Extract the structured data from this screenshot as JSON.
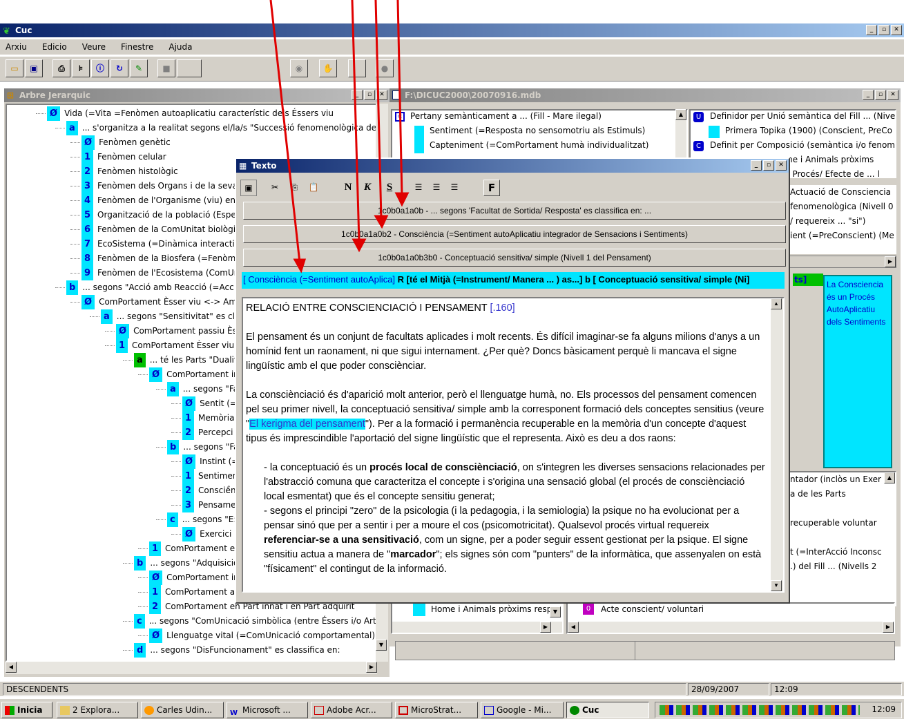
{
  "app": {
    "title": "Cuc"
  },
  "menu": [
    "Arxiu",
    "Edicio",
    "Veure",
    "Finestre",
    "Ajuda"
  ],
  "tree_window": {
    "title": "Arbre Jerarquic"
  },
  "tree_items": [
    {
      "badge": "Ø",
      "text": "Vida (=Vita =Fenòmen autoaplicatiu característic dels Éssers viu"
    },
    {
      "badge": "a",
      "text": "... s'organitza a la realitat segons el/la/s \"Successió fenomenològica de"
    },
    {
      "badge": "Ø",
      "text": "Fenòmen genètic"
    },
    {
      "badge": "1",
      "text": "Fenòmen celular"
    },
    {
      "badge": "2",
      "text": "Fenòmen histològic"
    },
    {
      "badge": "3",
      "text": "Fenòmen dels Organs i de la seva"
    },
    {
      "badge": "4",
      "text": "Fenòmen de l'Organisme (viu) en"
    },
    {
      "badge": "5",
      "text": "Organització de la població (Espe"
    },
    {
      "badge": "6",
      "text": "Fenòmen de la ComUnitat biològic"
    },
    {
      "badge": "7",
      "text": "EcoSistema (=Dinàmica interactiv"
    },
    {
      "badge": "8",
      "text": "Fenòmen de la Biosfera (=Fenòme"
    },
    {
      "badge": "9",
      "text": "Fenòmen de l'Ecosistema (ComUr"
    },
    {
      "badge": "b",
      "text": "... segons \"Acció amb Reacció (=Acc"
    },
    {
      "badge": "Ø",
      "text": "ComPortament Èsser viu <-> Amb"
    },
    {
      "badge": "a",
      "text": "... segons \"Sensitivitat\" es cla"
    },
    {
      "badge": "Ø",
      "text": "ComPortament passiu Èss"
    },
    {
      "badge": "1",
      "text": "ComPortament Èsser viu -"
    },
    {
      "badge": "a",
      "text": "... té les Parts \"Dualit"
    },
    {
      "badge": "Ø",
      "text": "ComPortament in"
    },
    {
      "badge": "a",
      "text": "... segons \"Fa"
    },
    {
      "badge": "Ø",
      "text": "Sentit (=F"
    },
    {
      "badge": "1",
      "text": "Memòria"
    },
    {
      "badge": "2",
      "text": "Percepci"
    },
    {
      "badge": "b",
      "text": "... segons \"Fa"
    },
    {
      "badge": "Ø",
      "text": "Instint (=I"
    },
    {
      "badge": "1",
      "text": "Sentimen"
    },
    {
      "badge": "2",
      "text": "Consciền"
    },
    {
      "badge": "3",
      "text": "Pensame"
    },
    {
      "badge": "c",
      "text": "... segons \"E:"
    },
    {
      "badge": "Ø",
      "text": "Exercici ("
    },
    {
      "badge": "1",
      "text": "ComPortament ex"
    },
    {
      "badge": "b",
      "text": "... segons \"Adquisició"
    },
    {
      "badge": "Ø",
      "text": "ComPortament in"
    },
    {
      "badge": "1",
      "text": "ComPortament ad"
    },
    {
      "badge": "2",
      "text": "ComPortament en Part innat i en Part adquirit"
    },
    {
      "badge": "c",
      "text": "... segons \"ComUnicació simbòlica (entre Éssers i/o Art"
    },
    {
      "badge": "Ø",
      "text": "Llenguatge vital (=ComUnicació comportamental)"
    },
    {
      "badge": "d",
      "text": "... segons \"DisFuncionament\" es classifica en:"
    }
  ],
  "db_window": {
    "title": "F:\\DICUC2000\\20070916.mdb"
  },
  "db_left": [
    "Pertany semànticament a ... (Fill - Mare ilegal)",
    "Sentiment (=Resposta no sensomotriu als Estimuls)",
    "Capteniment (=ComPortament humà individualitzat)"
  ],
  "db_right": [
    "Definidor per Unió semàntica del Fill ... (Nive",
    "Primera Topika (1900) (Conscient, PreCo",
    "Definit per Composició (semàntica i/o fenom",
    "me i Animals pròxims",
    "n/ Procés/ Efecte de ... |",
    "Actuació de Consciencia",
    "fenomenològica (Nivell 0",
    "/ requereix ... \"si\")",
    "ient (=PreConscient) (Me"
  ],
  "db_bottom_left": [
    "Home i Animals pròxims respe"
  ],
  "db_bottom_right": [
    "Acte conscient/ voluntari"
  ],
  "db_mid_right": [
    "ntador (inclòs un Exer",
    "a de les Parts",
    "recuperable voluntar",
    "t (=InterAcció Inconsc",
    ".) del Fill ... (Nivells 2"
  ],
  "side_note": {
    "tab": "ts]",
    "text": "La Consciencia és un Procés AutoAplicatiu dels Sentiments"
  },
  "texto": {
    "title": "Texto",
    "toolbar": [
      "N",
      "K",
      "S",
      "F"
    ],
    "code_buttons": [
      "1c0b0a1a0b - ... segons 'Facultat de Sortida/ Resposta' es classifica en: ...",
      "1c0b0a1a0b2 - Consciència (=Sentiment autoAplicatiu integrador de Sensacions i Sentiments)",
      "1c0b0a1a0b3b0 - Conceptuació sensitiva/ simple (Nivell 1 del Pensament)"
    ],
    "relation_a": "[ Consciència (=Sentiment autoAplica]",
    "relation_r": "R [té el Mitjà (=Instrument/ Manera ... ) as...]",
    "relation_b": "b [ Conceptuació sensitiva/ simple (Ni]",
    "heading": "RELACIÓ ENTRE CONSCIENCIACIÓ I PENSAMENT",
    "ref": "[.160]",
    "p1": "El pensament és un conjunt de facultats aplicades i molt recents. És difícil imaginar-se fa alguns milions d'anys a un homínid fent un raonament, ni que sigui internament. ¿Per què? Doncs bàsicament perquè li mancava el signe lingüístic amb el que poder consciènciar.",
    "p2a": "La consciènciació és d'aparició molt anterior, però el llenguatge humà, no. Els processos del pensament comencen pel seu primer nivell, la conceptuació sensitiva/ simple amb la corresponent formació dels conceptes sensitius (veure \"",
    "p2link": "El kerigma del pensament",
    "p2b": "\"). Per a la formació i permanència recuperable en la memòria d'un concepte d'aquest tipus és imprescindible l'aportació del signe lingüístic que el representa. Això es deu a dos raons:",
    "b1a": "- la conceptuació és un ",
    "b1bold": "procés local de consciènciació",
    "b1b": ", on s'integren les diverses sensacions relacionades per l'abstracció comuna que caracteritza el concepte i s'origina una sensació global (el procés de consciènciació local esmentat) que és el concepte sensitiu generat;",
    "b2a": "- segons el principi \"zero\" de la psicologia (i la pedagogia, i la semiologia) la psique no ha evolucionat per a pensar sinó que per a sentir i per a moure el cos (psicomotricitat). Qualsevol procés virtual requereix ",
    "b2bold": "referenciar-se a una sensitivació",
    "b2b": ", com un signe, per a poder seguir essent gestionat per la psique. El signe sensitiu actua a manera de \"",
    "b2bold2": "marcador",
    "b2c": "\"; els signes són com \"punters\" de la informàtica, que assenyalen on està \"físicament\" el contingut de la informació."
  },
  "status": {
    "left": "DESCENDENTS",
    "date": "28/09/2007",
    "time": "12:09"
  },
  "taskbar": {
    "start": "Inicia",
    "tasks": [
      "2 Explora...",
      "Carles Udin...",
      "Microsoft ...",
      "Adobe Acr...",
      "MicroStrat...",
      "Google - Mi...",
      "Cuc"
    ],
    "clock": "12:09"
  },
  "colors": {
    "titlebar": "#0a246a",
    "badge": "#00e5ff",
    "highlight": "#00e5ff",
    "arrow": "#e00000"
  }
}
